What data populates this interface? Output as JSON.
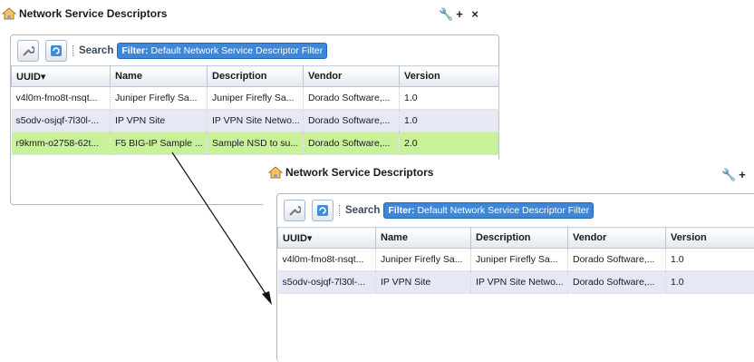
{
  "panel": {
    "title": "Network Service Descriptors",
    "tools": "+ ×",
    "search_label": "Search",
    "filter_prefix": "Filter:",
    "filter_value": "Default Network Service Descriptor Filter"
  },
  "table": {
    "columns": [
      "UUID▾",
      "Name",
      "Description",
      "Vendor",
      "Version"
    ],
    "rows": [
      [
        "v4l0m-fmo8t-nsqt...",
        "Juniper Firefly Sa...",
        "Juniper Firefly Sa...",
        "Dorado Software,...",
        "1.0"
      ],
      [
        "s5odv-osjqf-7l30l-...",
        "IP VPN Site",
        "IP VPN Site Netwo...",
        "Dorado Software,...",
        "1.0"
      ],
      [
        "r9kmm-o2758-62t...",
        "F5 BIG-IP Sample ...",
        "Sample NSD to su...",
        "Dorado Software,...",
        "2.0"
      ]
    ]
  },
  "colors": {
    "selected_row": "#c8f19a",
    "alt_row": "#e6e8f6",
    "filter_bg": "#3e86d8"
  }
}
